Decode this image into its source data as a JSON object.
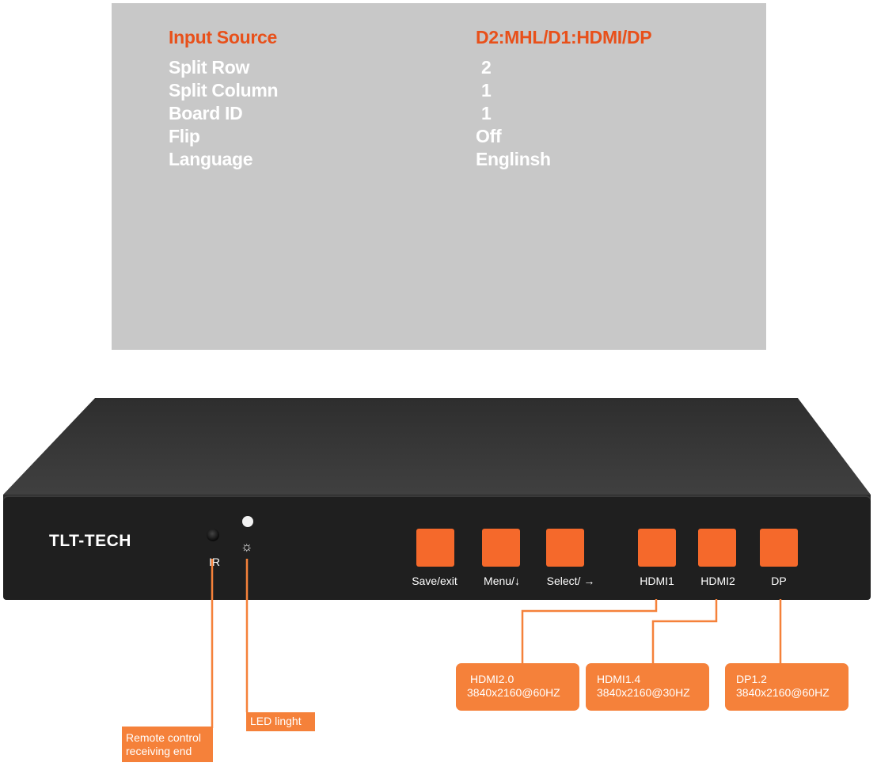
{
  "osd_menu": {
    "rows": [
      {
        "label": "Input Source",
        "value": "D2:MHL/D1:HDMI/DP",
        "highlighted": true
      },
      {
        "label": "Split Row",
        "value": "2",
        "highlighted": false
      },
      {
        "label": "Split Column",
        "value": "1",
        "highlighted": false
      },
      {
        "label": "Board ID",
        "value": "1",
        "highlighted": false
      },
      {
        "label": "Flip",
        "value": "Off",
        "highlighted": false
      },
      {
        "label": "Language",
        "value": "Englinsh",
        "highlighted": false
      }
    ],
    "highlight_color": "#e8501a",
    "background_color": "#c8c8c8"
  },
  "device": {
    "brand": "TLT-TECH",
    "ir_label": "IR",
    "led_icon": "sun-icon",
    "buttons": [
      {
        "label": "Save/exit"
      },
      {
        "label": "Menu/↓"
      },
      {
        "label": "Select/ →"
      },
      {
        "label": "HDMI1"
      },
      {
        "label": "HDMI2"
      },
      {
        "label": "DP"
      }
    ],
    "button_color": "#f5692b"
  },
  "callouts": {
    "color": "#f5813a",
    "ir": {
      "lines": [
        "Remote control",
        "receiving end"
      ]
    },
    "led": {
      "lines": [
        "LED linght"
      ]
    },
    "hdmi1": {
      "lines": [
        "HDMI2.0",
        "3840x2160@60HZ"
      ]
    },
    "hdmi2": {
      "lines": [
        "HDMI1.4",
        "3840x2160@30HZ"
      ]
    },
    "dp": {
      "lines": [
        "DP1.2",
        "3840x2160@60HZ"
      ]
    }
  }
}
